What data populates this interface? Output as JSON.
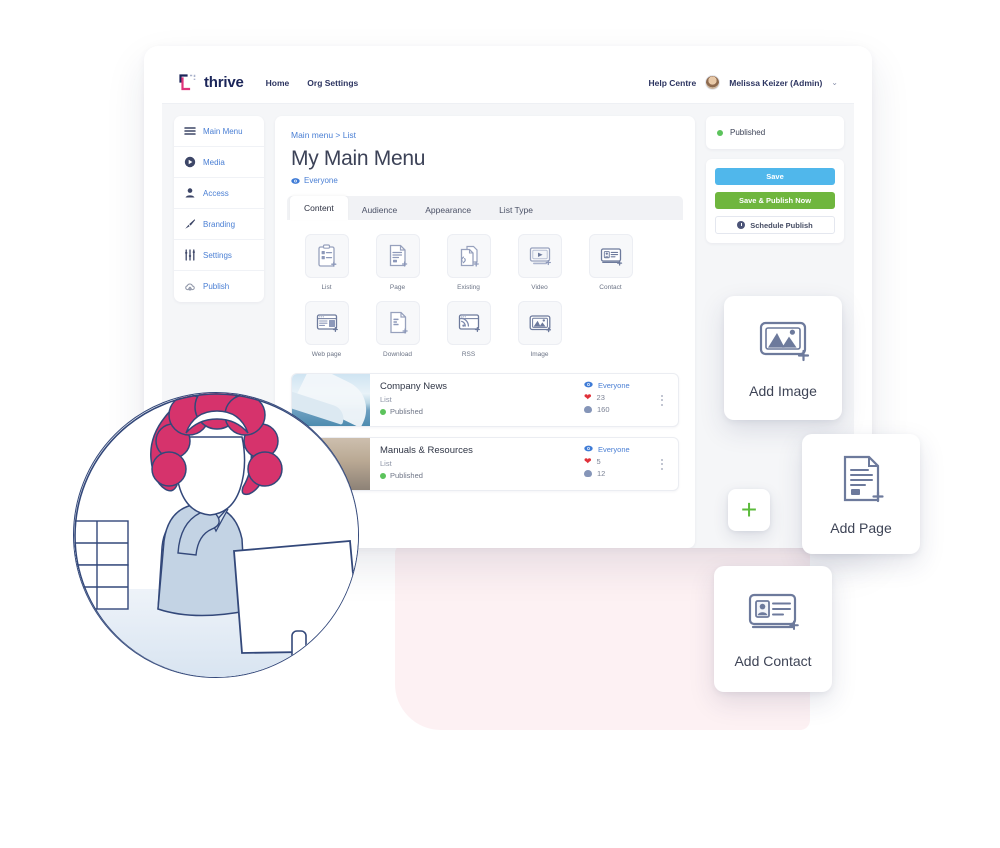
{
  "brand": {
    "name": "thrive",
    "accent_navy": "#1b2559",
    "accent_pink": "#e0337a"
  },
  "appbar": {
    "nav": [
      {
        "label": "Home"
      },
      {
        "label": "Org Settings"
      }
    ],
    "help_label": "Help Centre",
    "user_name": "Melissa Keizer (Admin)",
    "chevron": "⌄"
  },
  "sidebar": {
    "items": [
      {
        "label": "Main Menu",
        "icon": "hamburger-icon"
      },
      {
        "label": "Media",
        "icon": "play-circle-icon"
      },
      {
        "label": "Access",
        "icon": "person-icon"
      },
      {
        "label": "Branding",
        "icon": "brush-icon"
      },
      {
        "label": "Settings",
        "icon": "sliders-icon"
      },
      {
        "label": "Publish",
        "icon": "cloud-upload-icon"
      }
    ]
  },
  "main": {
    "breadcrumb": "Main menu > List",
    "title": "My Main Menu",
    "audience": "Everyone",
    "tabs": [
      {
        "label": "Content",
        "active": true
      },
      {
        "label": "Audience",
        "active": false
      },
      {
        "label": "Appearance",
        "active": false
      },
      {
        "label": "List Type",
        "active": false
      }
    ],
    "content_types": [
      {
        "label": "List",
        "icon": "clipboard-add-icon"
      },
      {
        "label": "Page",
        "icon": "document-add-icon"
      },
      {
        "label": "Existing",
        "icon": "link-documents-add-icon"
      },
      {
        "label": "Video",
        "icon": "video-add-icon"
      },
      {
        "label": "Contact",
        "icon": "contact-card-add-icon"
      },
      {
        "label": "Web page",
        "icon": "browser-add-icon"
      },
      {
        "label": "Download",
        "icon": "file-download-add-icon"
      },
      {
        "label": "RSS",
        "icon": "rss-add-icon"
      },
      {
        "label": "Image",
        "icon": "image-add-icon"
      }
    ],
    "rows": [
      {
        "name": "Company News",
        "type": "List",
        "status": "Published",
        "audience": "Everyone",
        "likes": "23",
        "views": "160",
        "thumb": "airplane-wing-photo"
      },
      {
        "name": "Manuals & Resources",
        "type": "List",
        "status": "Published",
        "audience": "Everyone",
        "likes": "5",
        "views": "12",
        "thumb": "warehouse-worker-photo"
      }
    ]
  },
  "rightpanel": {
    "status": "Published",
    "save_label": "Save",
    "publish_label": "Save & Publish Now",
    "schedule_label": "Schedule Publish"
  },
  "floating_cards": [
    {
      "label": "Add Image",
      "icon": "image-add-icon"
    },
    {
      "label": "Add Page",
      "icon": "document-add-icon"
    },
    {
      "label": "Add Contact",
      "icon": "contact-card-add-icon"
    }
  ],
  "plus_button": {
    "glyph": "+",
    "color": "#5cbb3c"
  },
  "illustration": {
    "name": "woman-thinking-at-computer",
    "hair_color": "#d6336c"
  }
}
